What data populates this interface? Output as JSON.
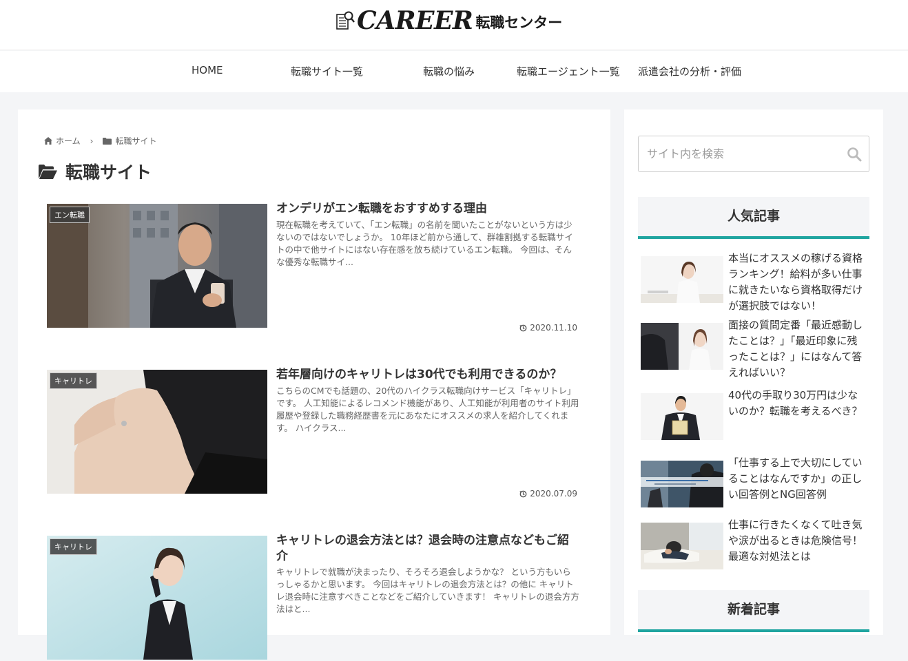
{
  "header": {
    "logo_main": "CAREER",
    "logo_sub": "転職センター"
  },
  "nav": {
    "items": [
      {
        "label": "HOME"
      },
      {
        "label": "転職サイト一覧"
      },
      {
        "label": "転職の悩み"
      },
      {
        "label": "転職エージェント一覧"
      },
      {
        "label": "派遣会社の分析・評価"
      }
    ]
  },
  "breadcrumb": {
    "home": "ホーム",
    "separator": "›",
    "category": "転職サイト"
  },
  "archive": {
    "title": "転職サイト"
  },
  "entries": [
    {
      "category": "エン転職",
      "title": "オンデリがエン転職をおすすめする理由",
      "snippet": "現在転職を考えていて、「エン転職」の名前を聞いたことがないという方は少ないのではないでしょうか。 10年ほど前から通して、群雄割拠する転職サイトの中で他サイトにはない存在感を放ち続けているエン転職。 今回は、そんな優秀な転職サイ...",
      "date": "2020.11.10"
    },
    {
      "category": "キャリトレ",
      "title": "若年層向けのキャリトレは30代でも利用できるのか？",
      "snippet": "こちらのCMでも話題の、20代のハイクラス転職向けサービス「キャリトレ」です。 人工知能によるレコメンド機能があり、人工知能が利用者のサイト利用履歴や登録した職務経歴書を元にあなたにオススメの求人を紹介してくれます。 ハイクラス...",
      "date": "2020.07.09"
    },
    {
      "category": "キャリトレ",
      "title": "キャリトレの退会方法とは？退会時の注意点などもご紹介",
      "snippet": "キャリトレで就職が決まったり、そろそろ退会しようかな？ という方もいらっしゃるかと思います。 今回はキャリトレの退会方法とは？の他に キャリトレ退会時に注意すべきことなどをご紹介していきます！ キャリトレの退会方方法はと...",
      "date": ""
    }
  ],
  "sidebar": {
    "search_placeholder": "サイト内を検索",
    "popular_title": "人気記事",
    "popular": [
      {
        "title": "本当にオススメの稼げる資格ランキング！給料が多い仕事に就きたいなら資格取得だけが選択肢ではない！"
      },
      {
        "title": "面接の質問定番「最近感動したことは？」「最近印象に残ったことは？」にはなんて答えればいい？"
      },
      {
        "title": "40代の手取り30万円は少ないのか？転職を考えるべき？"
      },
      {
        "title": "「仕事する上で大切にしていることはなんですか」の正しい回答例とNG回答例"
      },
      {
        "title": "仕事に行きたくなくて吐き気や涙が出るときは危険信号！最適な対処法とは"
      }
    ],
    "new_title": "新着記事"
  },
  "colors": {
    "accent": "#20a5a0",
    "background": "#f4f5f7"
  }
}
